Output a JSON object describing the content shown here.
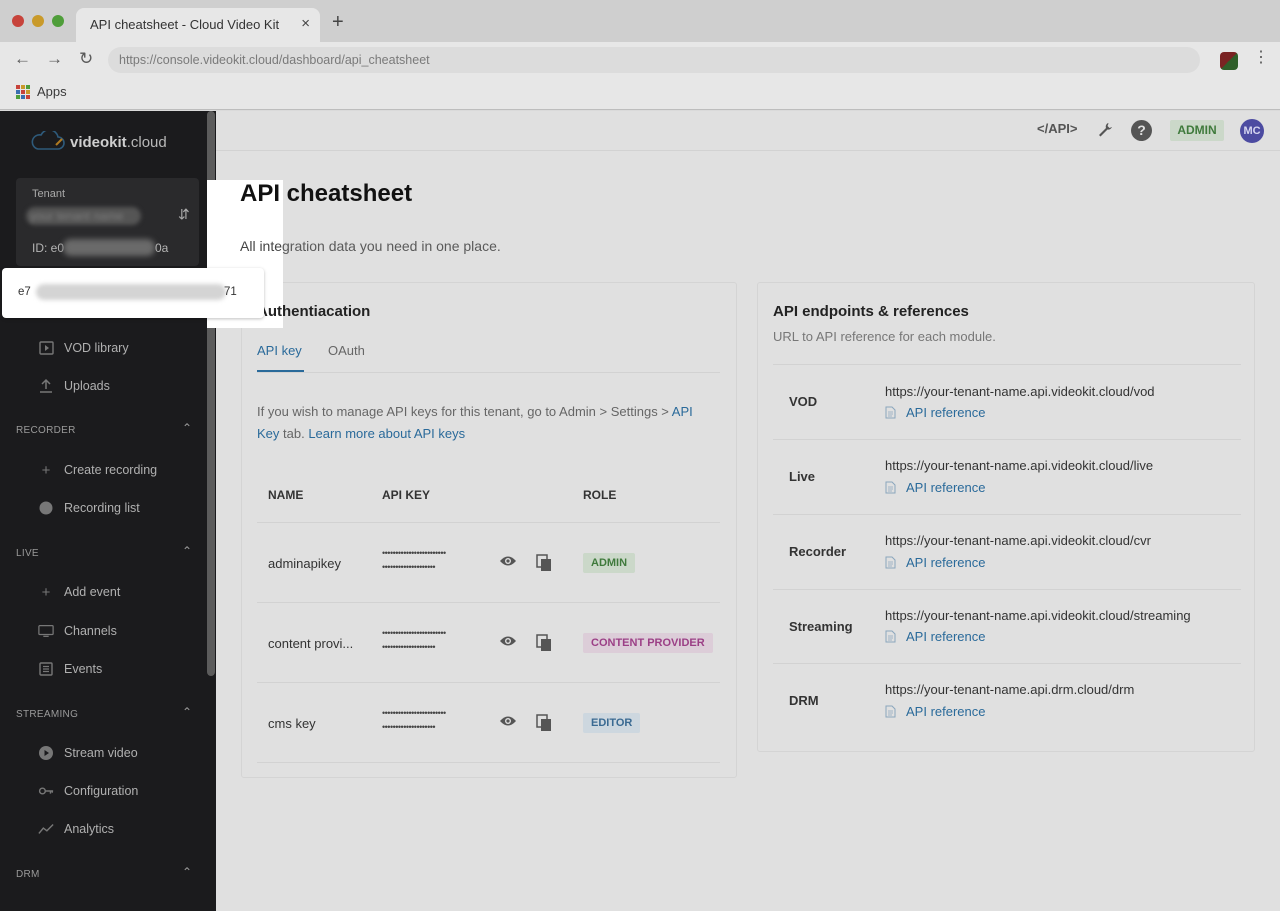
{
  "browser": {
    "tab_title": "API cheatsheet - Cloud Video Kit",
    "tab_close": "×",
    "new_tab": "+",
    "url": "https://console.videokit.cloud/dashboard/api_cheatsheet",
    "bookmarks_apps": "Apps",
    "apps_colors": [
      "#c7433b",
      "#c99a2a",
      "#4f9e3a",
      "#3a6fb0",
      "#c7433b",
      "#c99a2a",
      "#4f9e3a",
      "#3a6fb0",
      "#c7433b"
    ]
  },
  "sidebar": {
    "logo_prefix": "videokit",
    "logo_suffix": ".cloud",
    "tenant_label": "Tenant",
    "tenant_name": "your tenant name",
    "tenant_id_prefix": "ID: e0",
    "tenant_id_suffix": "0a",
    "sections": {
      "recorder": "RECORDER",
      "live": "LIVE",
      "streaming": "STREAMING",
      "drm": "DRM"
    },
    "items": {
      "vod_library": "VOD library",
      "uploads": "Uploads",
      "create_recording": "Create recording",
      "recording_list": "Recording list",
      "add_event": "Add event",
      "channels": "Channels",
      "events": "Events",
      "stream_video": "Stream video",
      "configuration": "Configuration",
      "analytics": "Analytics"
    }
  },
  "header": {
    "api_link": "</API>",
    "admin_badge": "ADMIN",
    "avatar_initials": "MC"
  },
  "page": {
    "title": "API cheatsheet",
    "subtitle": "All integration data you need in one place."
  },
  "auth": {
    "title": "Authentiacation",
    "tabs": [
      "API key",
      "OAuth"
    ],
    "help_text": "If you wish to manage API keys for this tenant, go to Admin > Settings > ",
    "help_link_tab": "API Key",
    "help_text_tab": " tab. ",
    "help_link_learn": "Learn more about API keys",
    "columns": [
      "NAME",
      "API KEY",
      "ROLE"
    ],
    "masked_key": "••••••••••••••••••••••••",
    "masked_key_2": "••••••••••••••••••••",
    "rows": [
      {
        "name": "adminapikey",
        "role": "ADMIN"
      },
      {
        "name": "content provi...",
        "role": "CONTENT PROVIDER"
      },
      {
        "name": "cms key",
        "role": "EDITOR"
      }
    ]
  },
  "endpoints": {
    "title": "API endpoints & references",
    "subtitle": "URL to API reference for each module.",
    "ref_label": "API reference",
    "items": [
      {
        "name": "VOD",
        "url": "https://your-tenant-name.api.videokit.cloud/vod"
      },
      {
        "name": "Live",
        "url": "https://your-tenant-name.api.videokit.cloud/live"
      },
      {
        "name": "Recorder",
        "url": "https://your-tenant-name.api.videokit.cloud/cvr"
      },
      {
        "name": "Streaming",
        "url": "https://your-tenant-name.api.videokit.cloud/streaming"
      },
      {
        "name": "DRM",
        "url": "https://your-tenant-name.api.drm.cloud/drm"
      }
    ]
  },
  "popup": {
    "id_prefix": "e7",
    "id_suffix": "71"
  }
}
